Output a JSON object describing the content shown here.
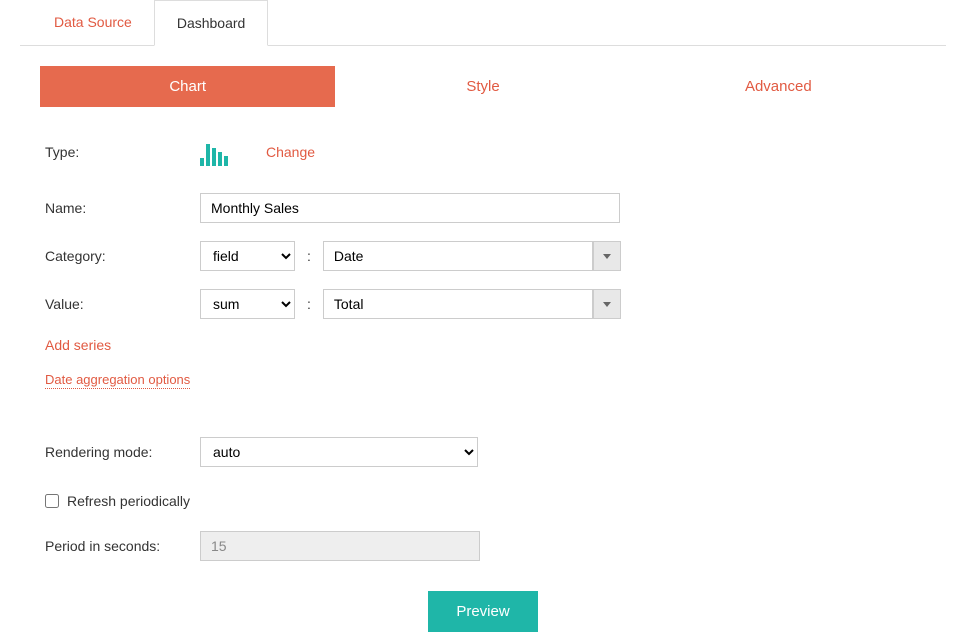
{
  "topTabs": {
    "dataSource": "Data Source",
    "dashboard": "Dashboard"
  },
  "subTabs": {
    "chart": "Chart",
    "style": "Style",
    "advanced": "Advanced"
  },
  "labels": {
    "type": "Type:",
    "name": "Name:",
    "category": "Category:",
    "value": "Value:",
    "renderingMode": "Rendering mode:",
    "refresh": "Refresh periodically",
    "period": "Period in seconds:"
  },
  "links": {
    "change": "Change",
    "addSeries": "Add series",
    "dateAgg": "Date aggregation options"
  },
  "fields": {
    "name": "Monthly Sales",
    "categoryMode": "field",
    "categoryField": "Date",
    "valueMode": "sum",
    "valueField": "Total",
    "renderingMode": "auto",
    "refreshChecked": false,
    "period": "15"
  },
  "buttons": {
    "preview": "Preview"
  },
  "colon": ":"
}
